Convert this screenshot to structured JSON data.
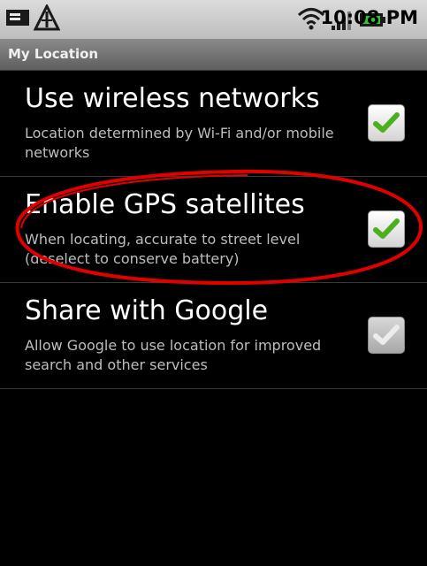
{
  "status_bar": {
    "time": "10:08 PM",
    "icons": [
      "notification-message-icon",
      "usb-debug-icon",
      "wifi-icon",
      "signal-icon",
      "battery-icon"
    ]
  },
  "title_bar": {
    "title": "My Location"
  },
  "settings": [
    {
      "title": "Use wireless networks",
      "summary": "Location determined by Wi-Fi and/or mobile networks",
      "checked": true,
      "enabled": true
    },
    {
      "title": "Enable GPS satellites",
      "summary": "When locating, accurate to street level (deselect to conserve battery)",
      "checked": true,
      "enabled": true
    },
    {
      "title": "Share with Google",
      "summary": "Allow Google to use location for improved search and other services",
      "checked": true,
      "enabled": false
    }
  ],
  "colors": {
    "check_active": "#4caf1e",
    "check_disabled": "#e8e8e8",
    "annotation": "#e00000",
    "background": "#000000",
    "title_text": "#ffffff",
    "summary_text": "#bdbdbd"
  }
}
